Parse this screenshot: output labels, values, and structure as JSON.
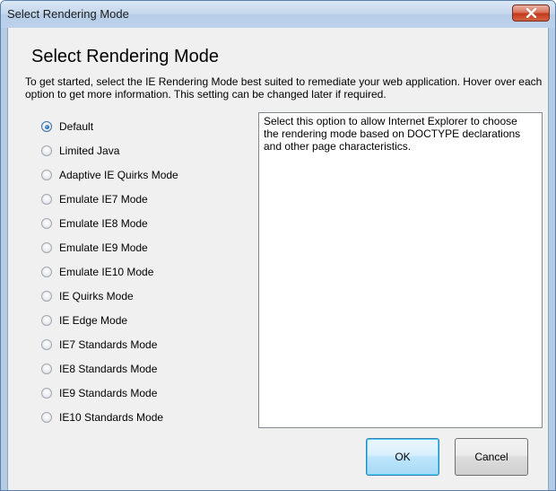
{
  "window": {
    "title": "Select Rendering Mode"
  },
  "main": {
    "heading": "Select Rendering Mode",
    "description": "To get started, select the IE Rendering Mode best suited to remediate your web application. Hover over each option to get more information. This setting can be changed later if required."
  },
  "options": [
    {
      "label": "Default",
      "checked": true
    },
    {
      "label": "Limited Java",
      "checked": false
    },
    {
      "label": "Adaptive IE Quirks Mode",
      "checked": false
    },
    {
      "label": "Emulate IE7 Mode",
      "checked": false
    },
    {
      "label": "Emulate IE8 Mode",
      "checked": false
    },
    {
      "label": "Emulate IE9 Mode",
      "checked": false
    },
    {
      "label": "Emulate IE10 Mode",
      "checked": false
    },
    {
      "label": "IE Quirks Mode",
      "checked": false
    },
    {
      "label": "IE Edge Mode",
      "checked": false
    },
    {
      "label": "IE7 Standards Mode",
      "checked": false
    },
    {
      "label": "IE8 Standards Mode",
      "checked": false
    },
    {
      "label": "IE9 Standards Mode",
      "checked": false
    },
    {
      "label": "IE10 Standards Mode",
      "checked": false
    }
  ],
  "info": {
    "text": "Select this option to allow Internet Explorer to choose the rendering mode based on DOCTYPE declarations and other page characteristics."
  },
  "buttons": {
    "ok": "OK",
    "cancel": "Cancel"
  },
  "icons": {
    "close": "close-icon",
    "radio": "radio-button"
  }
}
